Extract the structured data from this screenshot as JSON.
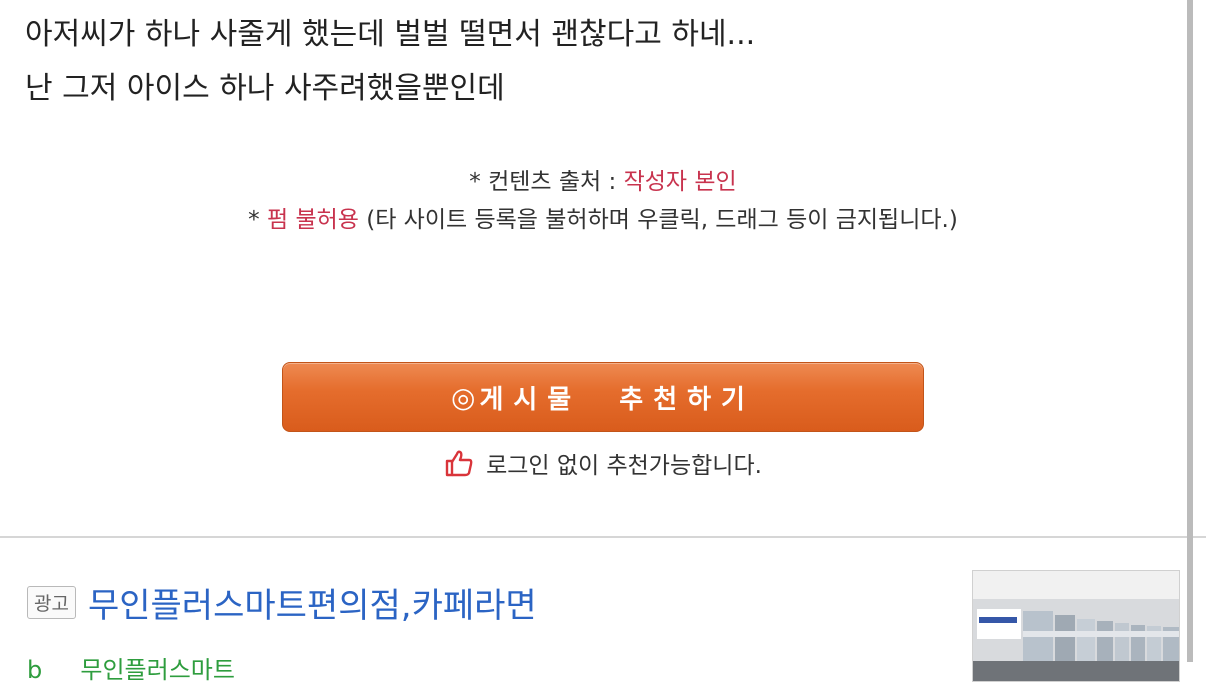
{
  "post": {
    "lines": [
      "아저씨가 하나 사줄게 했는데 벌벌 떨면서 괜찮다고 하네...",
      "난 그저 아이스 하나 사주려했을뿐인데"
    ]
  },
  "source": {
    "prefix1": "* 컨텐츠 출처 : ",
    "author": "작성자 본인",
    "prefix2": "* ",
    "no_copy": "펌 불허용",
    "no_copy_desc": " (타 사이트 등록을 불허하며 우클릭, 드래그 등이 금지됩니다.)"
  },
  "recommend": {
    "icon": "◎",
    "label": "게시물  추천하기",
    "login_note": "로그인 없이 추천가능합니다."
  },
  "ad": {
    "badge": "광고",
    "title": "무인플러스마트편의점,카페라면",
    "subtitle": "b     무인플러스마트"
  },
  "colors": {
    "accent_red": "#c8334e",
    "button_orange": "#e56d2d",
    "ad_link_blue": "#2b64c4",
    "ad_url_green": "#2e9d3e"
  },
  "icons": [
    "thumbs-up-icon",
    "target-icon"
  ]
}
